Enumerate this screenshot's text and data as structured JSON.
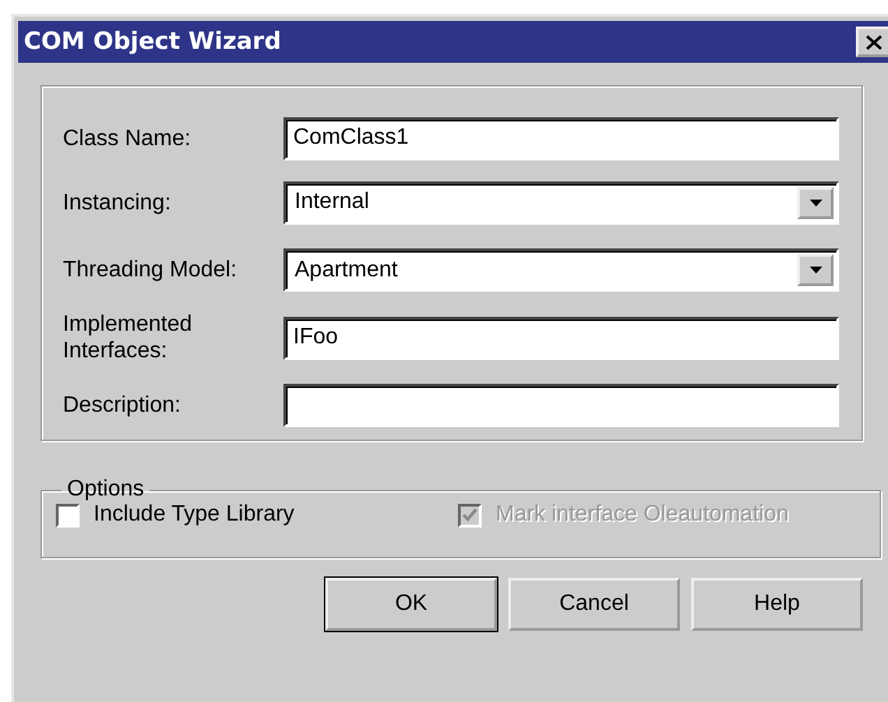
{
  "window": {
    "title": "COM Object Wizard"
  },
  "fields": [
    {
      "kind": "text",
      "label": "Class Name:",
      "value": "ComClass1"
    },
    {
      "kind": "dropdown",
      "label": "Instancing:",
      "value": "Internal"
    },
    {
      "kind": "dropdown",
      "label": "Threading Model:",
      "value": "Apartment"
    },
    {
      "kind": "text",
      "label": "Implemented Interfaces:",
      "value": "IFoo"
    },
    {
      "kind": "text",
      "label": "Description:"
    }
  ],
  "options": {
    "title": "Options",
    "checkboxes": [
      {
        "label": "Include Type Library",
        "checked": false,
        "disabled": false
      },
      {
        "label": "Mark interface Oleautomation",
        "checked": true,
        "disabled": true
      }
    ]
  },
  "buttons": [
    {
      "label": "OK",
      "default": true
    },
    {
      "label": "Cancel",
      "default": false
    },
    {
      "label": "Help",
      "default": false
    }
  ]
}
